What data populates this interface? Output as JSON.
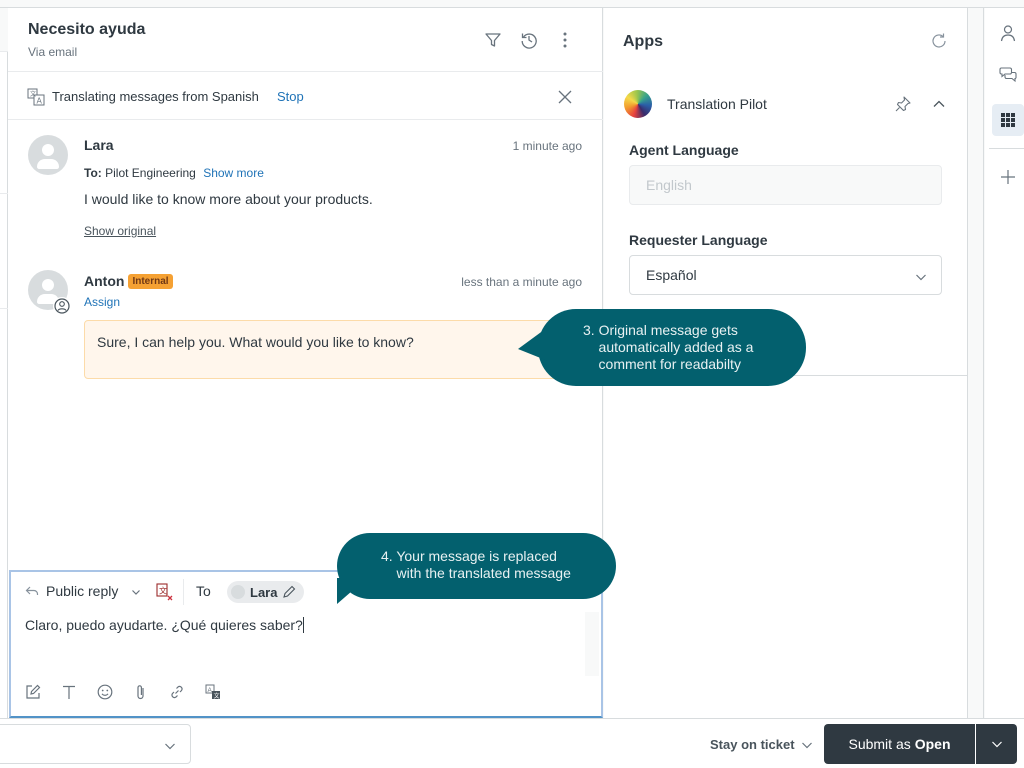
{
  "ticket": {
    "title": "Necesito ayuda",
    "channel": "Via email",
    "header_icons": [
      "filter-icon",
      "history-icon",
      "more-vertical-icon"
    ]
  },
  "translation_bar": {
    "text": "Translating messages from Spanish",
    "stop_label": "Stop"
  },
  "messages": [
    {
      "author": "Lara",
      "time": "1 minute ago",
      "to_label": "To:",
      "to_value": "Pilot Engineering",
      "show_more": "Show more",
      "body": "I would like to know more about your products.",
      "show_original": "Show original"
    },
    {
      "author": "Anton",
      "badge": "Internal",
      "time": "less than a minute ago",
      "assign": "Assign",
      "body": "Sure, I can help you. What would you like to know?"
    }
  ],
  "composer": {
    "reply_type": "Public reply",
    "to_label": "To",
    "recipient": "Lara",
    "body": "Claro, puedo ayudarte. ¿Qué quieres saber?",
    "toolbar": [
      "compose-icon",
      "text-format-icon",
      "emoji-icon",
      "attachment-icon",
      "link-icon",
      "translate-icon"
    ]
  },
  "apps": {
    "title": "Apps",
    "app_name": "Translation Pilot",
    "agent_language_label": "Agent Language",
    "agent_language_value": "English",
    "requester_language_label": "Requester Language",
    "requester_language_value": "Español"
  },
  "rail": [
    "user-icon",
    "conversations-icon",
    "apps-grid-icon",
    "add-icon"
  ],
  "footer": {
    "stay_label": "Stay on ticket",
    "submit_prefix": "Submit as",
    "submit_status": "Open"
  },
  "callouts": {
    "step3": "3. Original message gets\n    automatically added as a\n    comment for readabilty",
    "step4": "4. Your message is replaced\n    with the translated message"
  }
}
